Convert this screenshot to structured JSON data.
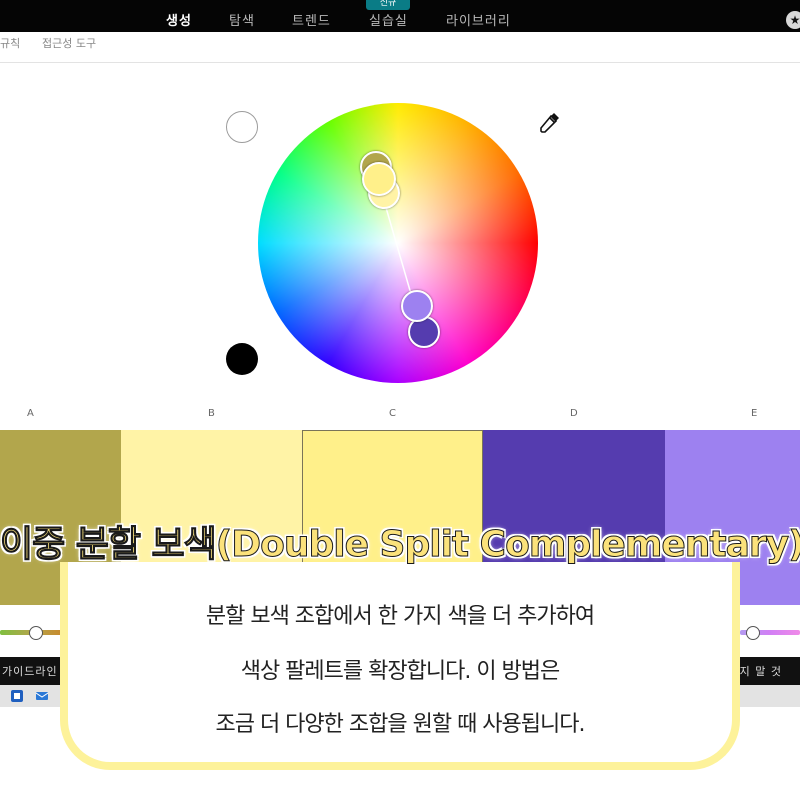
{
  "nav": {
    "items": [
      "생성",
      "탐색",
      "트렌드",
      "실습실",
      "라이브러리"
    ],
    "new_badge": "신규"
  },
  "subtabs": [
    "규칙",
    "접근성 도구"
  ],
  "columns": [
    "A",
    "B",
    "C",
    "D",
    "E"
  ],
  "swatch_colors": [
    "#b2a64c",
    "#fff3a6",
    "#fff08a",
    "#553caf",
    "#9d81f0"
  ],
  "bottom_bar": {
    "left": "가이드라인",
    "right": "지 말 것"
  },
  "overlay": {
    "title": "이중 분할 보색(Double Split Complementary)",
    "lines": [
      "분할 보색 조합에서 한 가지 색을 더 추가하여",
      "색상 팔레트를 확장합니다. 이 방법은",
      "조금 더 다양한 조합을 원할 때 사용됩니다."
    ]
  },
  "colors": {
    "highlight_yellow": "#fdf29a",
    "title_yellow": "#fbe27b",
    "new_badge": "#0a7c86"
  },
  "icons": {
    "eyedropper": "eyedropper-icon",
    "star": "star-icon"
  }
}
